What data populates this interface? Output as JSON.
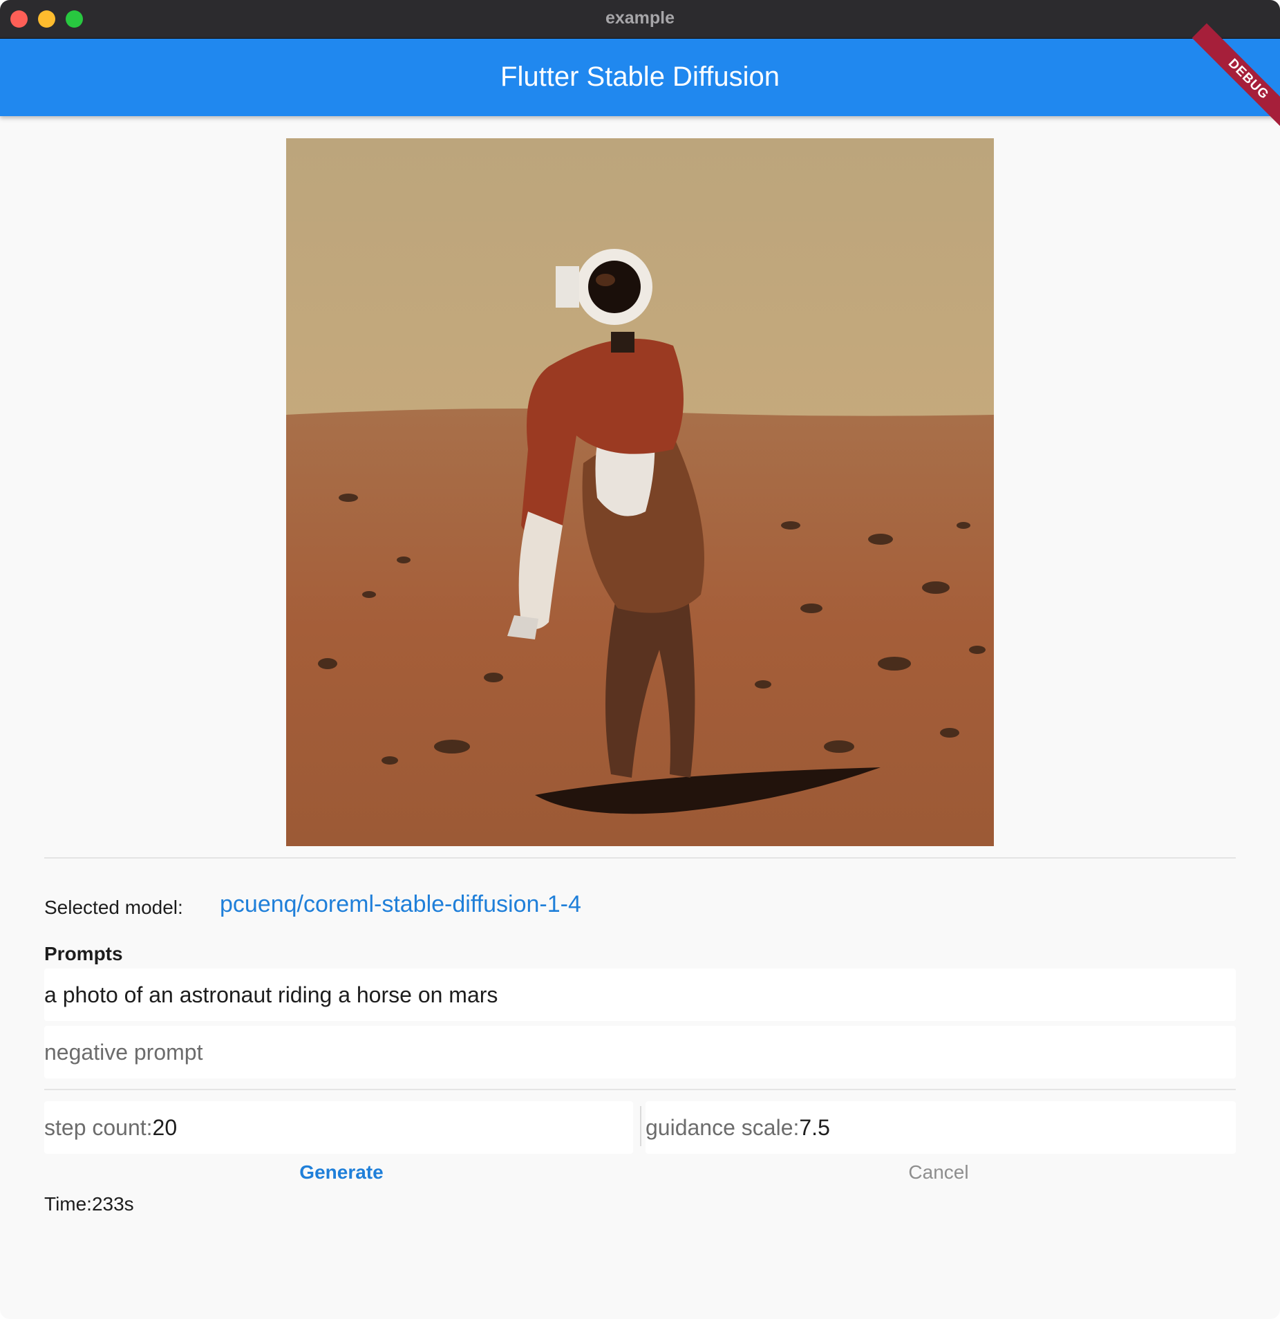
{
  "window": {
    "title": "example"
  },
  "appbar": {
    "title": "Flutter Stable Diffusion",
    "debug_banner": "DEBUG"
  },
  "colors": {
    "appbar": "#2088ef",
    "link": "#1f7fd9",
    "debug_ribbon": "#a61f3a"
  },
  "image": {
    "icon": "generated-image"
  },
  "model": {
    "label": "Selected model:",
    "value": "pcuenq/coreml-stable-diffusion-1-4"
  },
  "prompts": {
    "heading": "Prompts",
    "prompt_value": "a photo of an astronaut riding a horse on mars",
    "negative_placeholder": "negative prompt"
  },
  "params": {
    "step_label": "step count:",
    "step_value": "20",
    "guidance_label": "guidance scale:",
    "guidance_value": "7.5"
  },
  "actions": {
    "generate": "Generate",
    "cancel": "Cancel"
  },
  "status": {
    "time": "Time:233s"
  }
}
